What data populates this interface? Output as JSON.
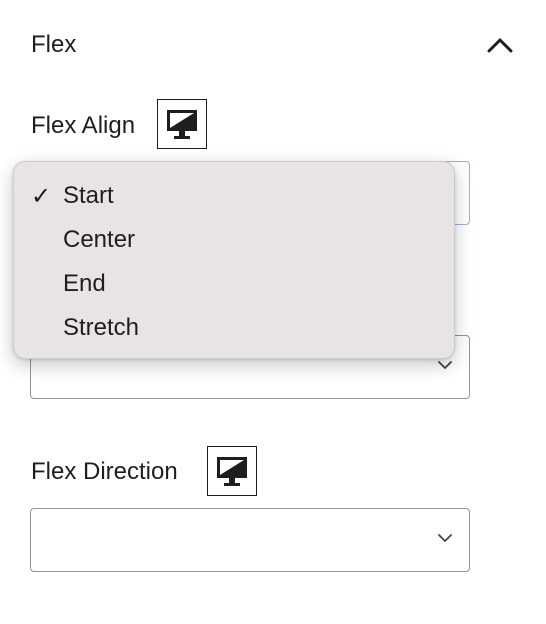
{
  "panel": {
    "title": "Flex"
  },
  "fields": {
    "flex_align": {
      "label": "Flex Align",
      "value": "",
      "device_icon": "desktop-icon",
      "options": [
        {
          "label": "Start",
          "selected": true
        },
        {
          "label": "Center",
          "selected": false
        },
        {
          "label": "End",
          "selected": false
        },
        {
          "label": "Stretch",
          "selected": false
        }
      ],
      "check_mark": "✓"
    },
    "flex_justify": {
      "value": ""
    },
    "flex_direction": {
      "label": "Flex Direction",
      "value": "",
      "device_icon": "desktop-icon"
    }
  },
  "colors": {
    "text": "#1e1e1e",
    "select_border": "#949494",
    "focus_border": "#8fb3d9",
    "menu_bg": "#e8e3e4"
  }
}
